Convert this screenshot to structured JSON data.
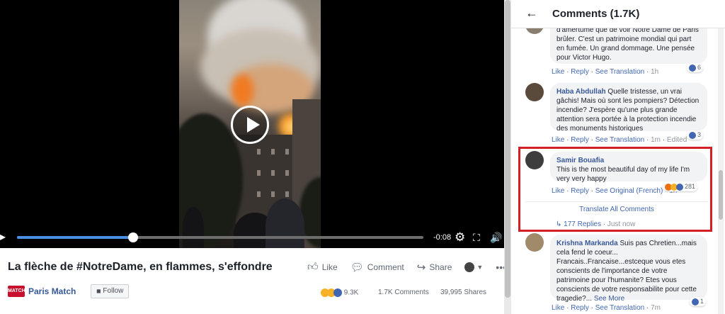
{
  "video": {
    "time_remaining": "-0:08",
    "progress": 0.29
  },
  "post": {
    "title": "La flèche de #NotreDame, en flammes, s'effondre",
    "actions": {
      "like": "Like",
      "comment": "Comment",
      "share": "Share"
    },
    "page_logo_text": "MATCH",
    "page_name": "Paris Match",
    "follow": "Follow",
    "reactions_count": "9.3K",
    "comments_count": "1.7K Comments",
    "shares_count": "39,995 Shares"
  },
  "comments_panel": {
    "title": "Comments (1.7K)",
    "comments": [
      {
        "text": "d'amertume que de voir Notre Dame de Paris brûler. C'est un patrimoine mondial qui part en fumée. Un grand dommage. Une pensée pour Victor Hugo.",
        "like": "Like",
        "reply": "Reply",
        "translation": "See Translation",
        "time": "1h",
        "reactions": "6"
      },
      {
        "author": "Haba Abdullah",
        "text": "Quelle tristesse, un vrai gâchis! Mais où sont les pompiers? Détection incendie? J'espère qu'une plus grande attention sera portée à la protection incendie des monuments historiques",
        "like": "Like",
        "reply": "Reply",
        "translation": "See Translation",
        "time": "1m",
        "edited": "Edited",
        "reactions": "3"
      },
      {
        "author": "Samir Bouafia",
        "text": "This is the most beautiful day of my life I'm very very happy",
        "like": "Like",
        "reply": "Reply",
        "translation": "See Original (French)",
        "time": "1h",
        "reactions": "281",
        "translate_all": "Translate All Comments",
        "replies": "177 Replies",
        "replies_time": "Just now"
      },
      {
        "author": "Krishna Markanda",
        "text": "Suis pas Chretien...mais cela fend le coeur... Francais..Francaise...estceque vous etes conscients de l'importance de votre patrimoine pour l'humanite? Etes vous conscients de votre responsabilite pour cette tragedie?...",
        "see_more": "See More",
        "like": "Like",
        "reply": "Reply",
        "translation": "See Translation",
        "time": "7m",
        "reactions": "1"
      }
    ]
  },
  "colors": {
    "brand_blue": "#4267b2",
    "highlight_red": "#d32027",
    "logo_red": "#c8102e"
  }
}
